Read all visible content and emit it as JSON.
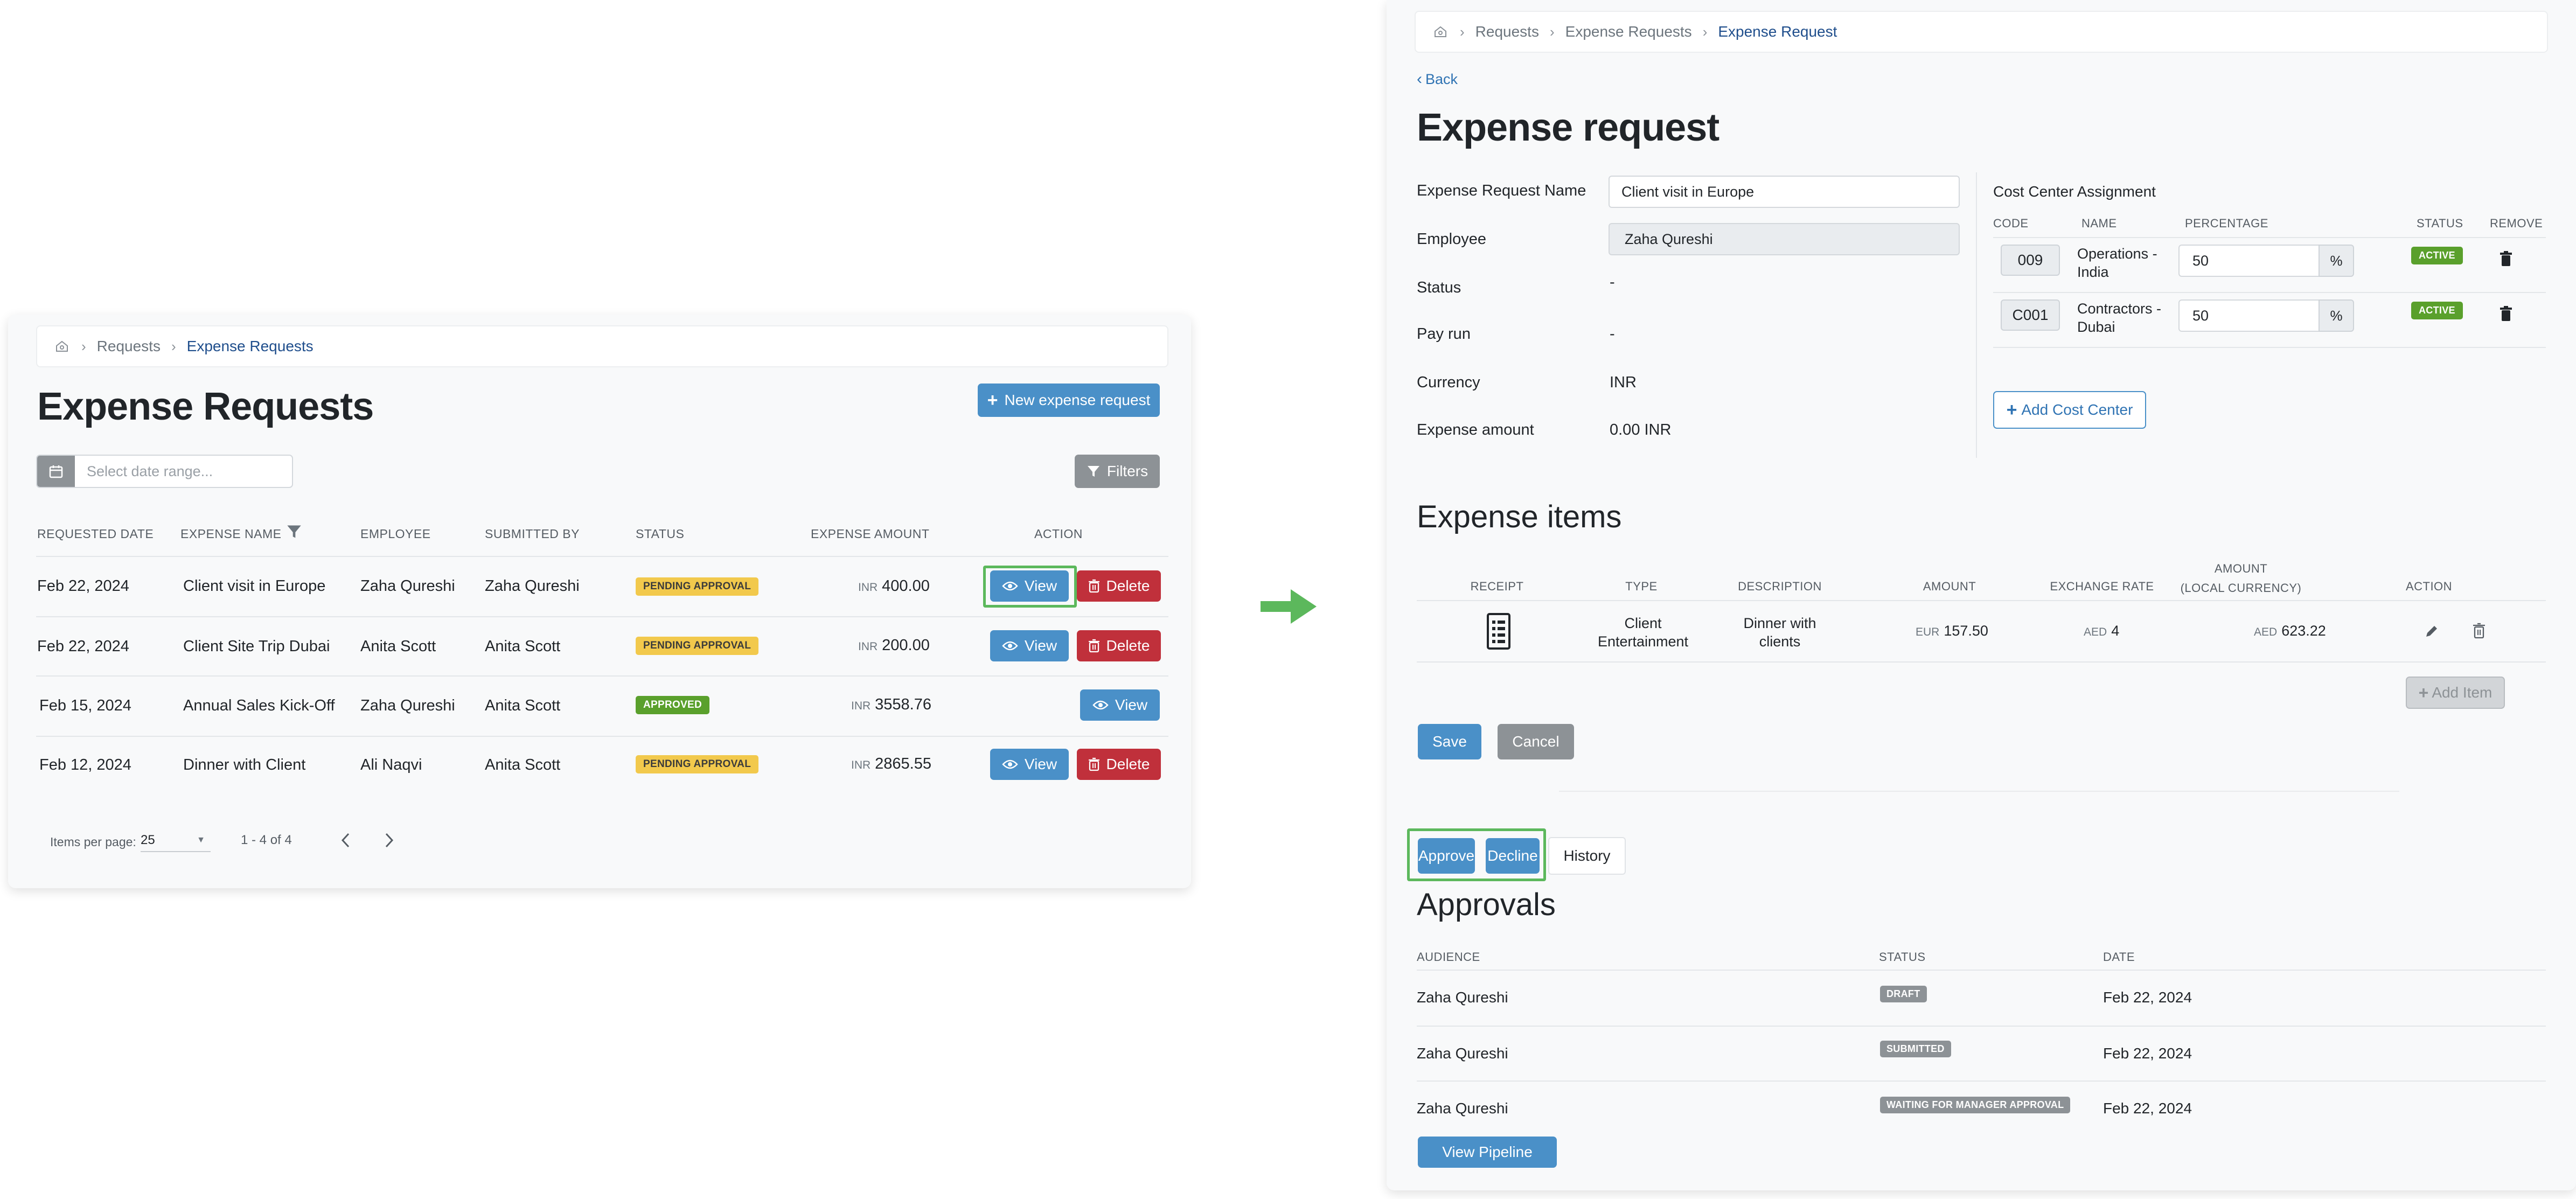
{
  "list_page": {
    "breadcrumb": [
      "Requests",
      "Expense Requests"
    ],
    "title": "Expense Requests",
    "new_button": "New expense request",
    "date_placeholder": "Select date range...",
    "filters_button": "Filters",
    "columns": [
      "REQUESTED DATE",
      "EXPENSE NAME",
      "EMPLOYEE",
      "SUBMITTED BY",
      "STATUS",
      "EXPENSE AMOUNT",
      "ACTION"
    ],
    "rows": [
      {
        "date": "Feb 22, 2024",
        "name": "Client visit in Europe",
        "employee": "Zaha Qureshi",
        "submitted_by": "Zaha Qureshi",
        "status": "PENDING APPROVAL",
        "currency": "INR",
        "amount": "400.00"
      },
      {
        "date": "Feb 22, 2024",
        "name": "Client Site Trip Dubai",
        "employee": "Anita Scott",
        "submitted_by": "Anita Scott",
        "status": "PENDING APPROVAL",
        "currency": "INR",
        "amount": "200.00"
      },
      {
        "date": "Feb 15, 2024",
        "name": "Annual Sales Kick-Off",
        "employee": "Zaha Qureshi",
        "submitted_by": "Anita Scott",
        "status": "APPROVED",
        "currency": "INR",
        "amount": "3558.76"
      },
      {
        "date": "Feb 12, 2024",
        "name": "Dinner with Client",
        "employee": "Ali Naqvi",
        "submitted_by": "Anita Scott",
        "status": "PENDING APPROVAL",
        "currency": "INR",
        "amount": "2865.55"
      }
    ],
    "view_label": "View",
    "delete_label": "Delete",
    "items_per_page_label": "Items per page:",
    "items_per_page": "25",
    "range_text": "1 - 4 of 4"
  },
  "detail_page": {
    "breadcrumb": [
      "Requests",
      "Expense Requests",
      "Expense Request"
    ],
    "back": "Back",
    "title": "Expense request",
    "fields": {
      "name_label": "Expense Request Name",
      "name_value": "Client visit in Europe",
      "employee_label": "Employee",
      "employee_value": "Zaha Qureshi",
      "status_label": "Status",
      "status_value": "-",
      "payrun_label": "Pay run",
      "payrun_value": "-",
      "currency_label": "Currency",
      "currency_value": "INR",
      "amount_label": "Expense amount",
      "amount_value": "0.00 INR"
    },
    "cost_center": {
      "title": "Cost Center Assignment",
      "columns": [
        "CODE",
        "NAME",
        "PERCENTAGE",
        "STATUS",
        "REMOVE"
      ],
      "rows": [
        {
          "code": "009",
          "name": "Operations - India",
          "pct": "50",
          "status": "ACTIVE"
        },
        {
          "code": "C001",
          "name": "Contractors - Dubai",
          "pct": "50",
          "status": "ACTIVE"
        }
      ],
      "pct_symbol": "%",
      "add_button": "Add Cost Center"
    },
    "expense_items": {
      "title": "Expense items",
      "columns": [
        "RECEIPT",
        "TYPE",
        "DESCRIPTION",
        "AMOUNT",
        "EXCHANGE RATE",
        "AMOUNT (LOCAL CURRENCY)",
        "ACTION"
      ],
      "col_amount_local_1": "AMOUNT",
      "col_amount_local_2": "(LOCAL CURRENCY)",
      "row": {
        "type": "Client Entertainment",
        "description": "Dinner with clients",
        "amount_cur": "EUR",
        "amount": "157.50",
        "rate_cur": "AED",
        "rate": "4",
        "local_cur": "AED",
        "local": "623.22"
      },
      "add_item": "Add Item",
      "save": "Save",
      "cancel": "Cancel"
    },
    "approve": "Approve",
    "decline": "Decline",
    "history": "History",
    "approvals": {
      "title": "Approvals",
      "columns": [
        "AUDIENCE",
        "STATUS",
        "DATE"
      ],
      "rows": [
        {
          "audience": "Zaha Qureshi",
          "status": "DRAFT",
          "date": "Feb 22, 2024"
        },
        {
          "audience": "Zaha Qureshi",
          "status": "SUBMITTED",
          "date": "Feb 22, 2024"
        },
        {
          "audience": "Zaha Qureshi",
          "status": "WAITING FOR MANAGER APPROVAL",
          "date": "Feb 22, 2024"
        }
      ],
      "pipeline": "View Pipeline"
    }
  }
}
